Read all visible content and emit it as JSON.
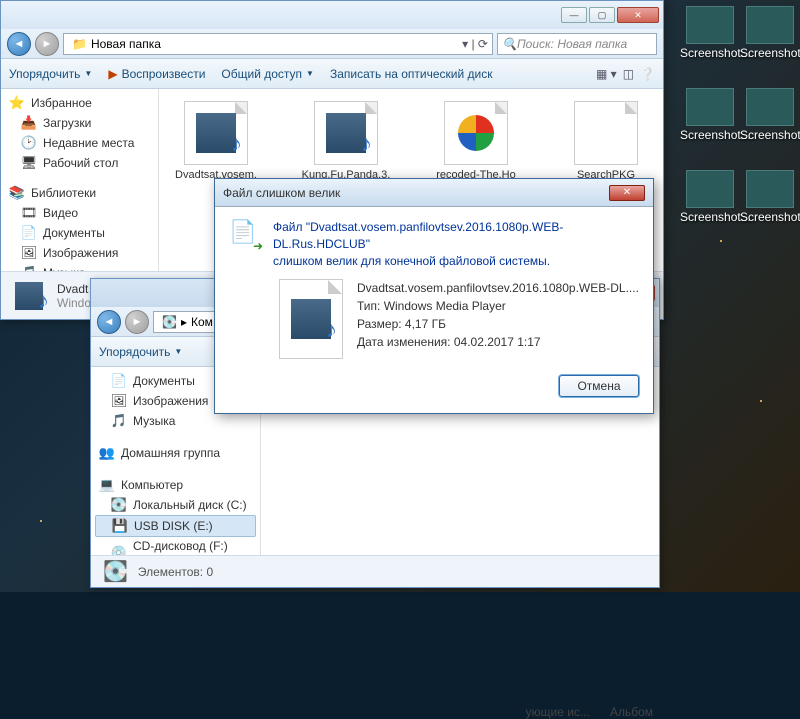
{
  "desktop_icons": [
    {
      "label": "Screenshot..."
    },
    {
      "label": "Screenshot..."
    },
    {
      "label": "Screenshot..."
    },
    {
      "label": "Screenshot..."
    },
    {
      "label": "Screenshot..."
    },
    {
      "label": "Screenshot..."
    }
  ],
  "win1": {
    "breadcrumb": "Новая папка",
    "search_placeholder": "Поиск: Новая папка",
    "toolbar": {
      "organize": "Упорядочить",
      "play": "Воспроизвести",
      "share": "Общий доступ",
      "burn": "Записать на оптический диск"
    },
    "sidebar": {
      "favorites": "Избранное",
      "downloads": "Загрузки",
      "recent": "Недавние места",
      "desktop": "Рабочий стол",
      "libraries": "Библиотеки",
      "videos": "Видео",
      "documents": "Документы",
      "pictures": "Изображения",
      "music": "Музыка"
    },
    "files": [
      {
        "name": "Dvadtsat.vosem.",
        "type": "media"
      },
      {
        "name": "Kung.Fu.Panda.3.",
        "type": "media"
      },
      {
        "name": "recoded-The.Ho",
        "type": "globe"
      },
      {
        "name": "SearchPKG",
        "type": "blank"
      }
    ],
    "detail_name": "Dvadt",
    "detail_sub": "Windo"
  },
  "win2": {
    "breadcrumb": "Ком",
    "toolbar": {
      "organize": "Упорядочить"
    },
    "sidebar": {
      "documents": "Документы",
      "pictures": "Изображения",
      "music": "Музыка",
      "homegroup": "Домашняя группа",
      "computer": "Компьютер",
      "localdisk": "Локальный диск (C:)",
      "usb": "USB DISK (E:)",
      "cd": "CD-дисковод (F:) Beeline"
    },
    "columns": {
      "c1": "ующие ис...",
      "c2": "Альбом"
    },
    "status": "Элементов: 0"
  },
  "dialog": {
    "title": "Файл слишком велик",
    "msg1": "Файл \"Dvadtsat.vosem.panfilovtsev.2016.1080p.WEB-DL.Rus.HDCLUB\"",
    "msg2": "слишком велик для конечной файловой системы.",
    "info_name": "Dvadtsat.vosem.panfilovtsev.2016.1080p.WEB-DL....",
    "info_type_label": "Тип:",
    "info_type": "Windows Media Player",
    "info_size_label": "Размер:",
    "info_size": "4,17 ГБ",
    "info_date_label": "Дата изменения:",
    "info_date": "04.02.2017 1:17",
    "cancel": "Отмена"
  }
}
